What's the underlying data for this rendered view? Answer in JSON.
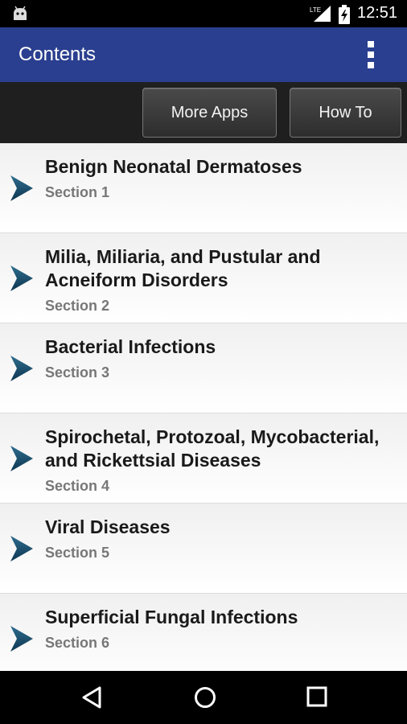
{
  "status_bar": {
    "time": "12:51",
    "network_label": "LTE",
    "icons": [
      "android-icon",
      "lte-signal-icon",
      "battery-charging-icon"
    ]
  },
  "app_bar": {
    "title": "Contents",
    "overflow_icon": "more-vert-icon",
    "color": "#2a3f8f"
  },
  "toolbar": {
    "more_apps_label": "More Apps",
    "how_to_label": "How To"
  },
  "sections": [
    {
      "title": "Benign Neonatal Dermatoses",
      "subtitle": "Section 1"
    },
    {
      "title": "Milia, Miliaria, and Pustular and Acneiform Disorders",
      "subtitle": "Section 2"
    },
    {
      "title": "Bacterial Infections",
      "subtitle": "Section 3"
    },
    {
      "title": "Spirochetal, Protozoal, Mycobacterial, and Rickettsial Diseases",
      "subtitle": "Section 4"
    },
    {
      "title": "Viral Diseases",
      "subtitle": "Section 5"
    },
    {
      "title": "Superficial Fungal Infections",
      "subtitle": "Section 6"
    }
  ],
  "nav_bar": {
    "icons": [
      "back-icon",
      "home-icon",
      "recents-icon"
    ]
  }
}
